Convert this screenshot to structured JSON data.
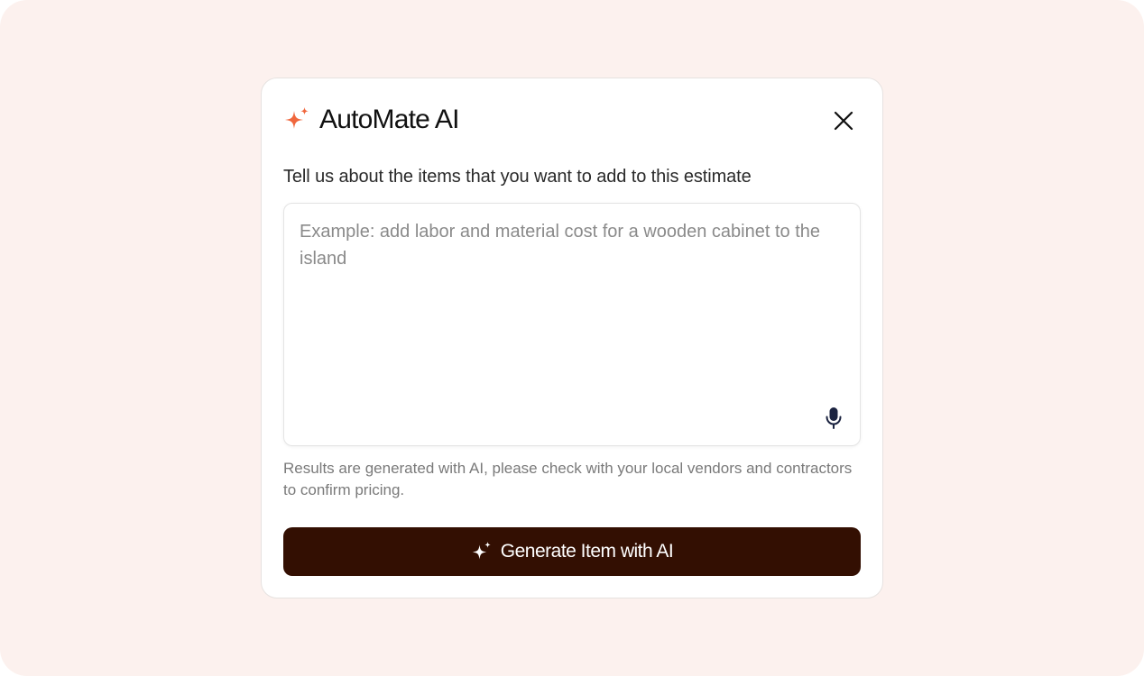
{
  "modal": {
    "title": "AutoMate AI",
    "title_icon": "sparkle-icon",
    "close_icon": "close-icon",
    "prompt_label": "Tell us about the items that you want to add to this estimate",
    "input": {
      "value": "",
      "placeholder": "Example: add labor and material cost for a wooden cabinet to the island",
      "mic_icon": "microphone-icon"
    },
    "disclaimer": "Results are generated with AI, please check with your local vendors and contractors to confirm pricing.",
    "generate_button": {
      "label": "Generate Item with AI",
      "icon": "sparkle-icon"
    }
  },
  "colors": {
    "backdrop": "#fcf1ee",
    "accent": "#f0673d",
    "button_bg": "#330f02",
    "mic": "#1b2340"
  }
}
